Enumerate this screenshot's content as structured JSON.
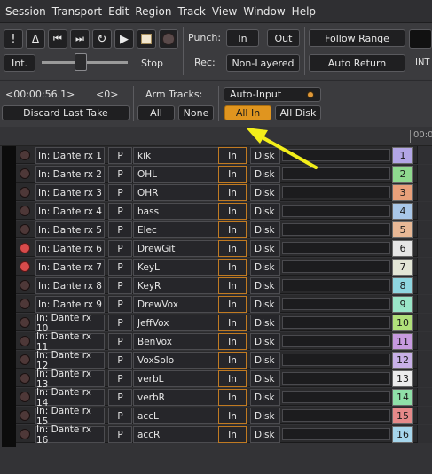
{
  "menu": [
    "Session",
    "Transport",
    "Edit",
    "Region",
    "Track",
    "View",
    "Window",
    "Help"
  ],
  "transport": {
    "mode_button": "Int.",
    "stop_label": "Stop",
    "punch_label": "Punch:",
    "punch_in": "In",
    "punch_out": "Out",
    "rec_label": "Rec:",
    "rec_mode": "Non-Layered",
    "follow_range": "Follow Range",
    "auto_return": "Auto Return",
    "int_label": "INT"
  },
  "session": {
    "clock": "<00:00:56.1>",
    "xruns": "<0>",
    "discard": "Discard Last Take",
    "arm_tracks_label": "Arm Tracks:",
    "arm_all": "All",
    "arm_none": "None",
    "auto_input": "Auto-Input",
    "all_in": "All In",
    "all_disk": "All Disk"
  },
  "ruler": {
    "time": "00:0"
  },
  "tracks": [
    {
      "input": "In: Dante rx 1",
      "p": "P",
      "name": "kik",
      "in": "In",
      "disk": "Disk",
      "num": "1",
      "color": "#b3a6e6",
      "armed": false
    },
    {
      "input": "In: Dante rx 2",
      "p": "P",
      "name": "OHL",
      "in": "In",
      "disk": "Disk",
      "num": "2",
      "color": "#8fd98f",
      "armed": false
    },
    {
      "input": "In: Dante rx 3",
      "p": "P",
      "name": "OHR",
      "in": "In",
      "disk": "Disk",
      "num": "3",
      "color": "#e8a07a",
      "armed": false
    },
    {
      "input": "In: Dante rx 4",
      "p": "P",
      "name": "bass",
      "in": "In",
      "disk": "Disk",
      "num": "4",
      "color": "#a9c7e8",
      "armed": false
    },
    {
      "input": "In: Dante rx 5",
      "p": "P",
      "name": "Elec",
      "in": "In",
      "disk": "Disk",
      "num": "5",
      "color": "#e8b896",
      "armed": false
    },
    {
      "input": "In: Dante rx 6",
      "p": "P",
      "name": "DrewGit",
      "in": "In",
      "disk": "Disk",
      "num": "6",
      "color": "#e6e6e6",
      "armed": true
    },
    {
      "input": "In: Dante rx 7",
      "p": "P",
      "name": "KeyL",
      "in": "In",
      "disk": "Disk",
      "num": "7",
      "color": "#e3e6d6",
      "armed": true
    },
    {
      "input": "In: Dante rx 8",
      "p": "P",
      "name": "KeyR",
      "in": "In",
      "disk": "Disk",
      "num": "8",
      "color": "#8fd6e0",
      "armed": false
    },
    {
      "input": "In: Dante rx 9",
      "p": "P",
      "name": "DrewVox",
      "in": "In",
      "disk": "Disk",
      "num": "9",
      "color": "#9ae6c8",
      "armed": false
    },
    {
      "input": "In: Dante rx 10",
      "p": "P",
      "name": "JeffVox",
      "in": "In",
      "disk": "Disk",
      "num": "10",
      "color": "#b0e07a",
      "armed": false
    },
    {
      "input": "In: Dante rx 11",
      "p": "P",
      "name": "BenVox",
      "in": "In",
      "disk": "Disk",
      "num": "11",
      "color": "#c79ae0",
      "armed": false
    },
    {
      "input": "In: Dante rx 12",
      "p": "P",
      "name": "VoxSolo",
      "in": "In",
      "disk": "Disk",
      "num": "12",
      "color": "#c8b0e8",
      "armed": false
    },
    {
      "input": "In: Dante rx 13",
      "p": "P",
      "name": "verbL",
      "in": "In",
      "disk": "Disk",
      "num": "13",
      "color": "#ececec",
      "armed": false
    },
    {
      "input": "In: Dante rx 14",
      "p": "P",
      "name": "verbR",
      "in": "In",
      "disk": "Disk",
      "num": "14",
      "color": "#8fe0a8",
      "armed": false
    },
    {
      "input": "In: Dante rx 15",
      "p": "P",
      "name": "accL",
      "in": "In",
      "disk": "Disk",
      "num": "15",
      "color": "#e58a8a",
      "armed": false
    },
    {
      "input": "In: Dante rx 16",
      "p": "P",
      "name": "accR",
      "in": "In",
      "disk": "Disk",
      "num": "16",
      "color": "#a6d6ec",
      "armed": false
    }
  ],
  "colors": {
    "accent": "#e0951f",
    "armed": "#d84b4b",
    "annotation_arrow": "#f2ee1a"
  }
}
